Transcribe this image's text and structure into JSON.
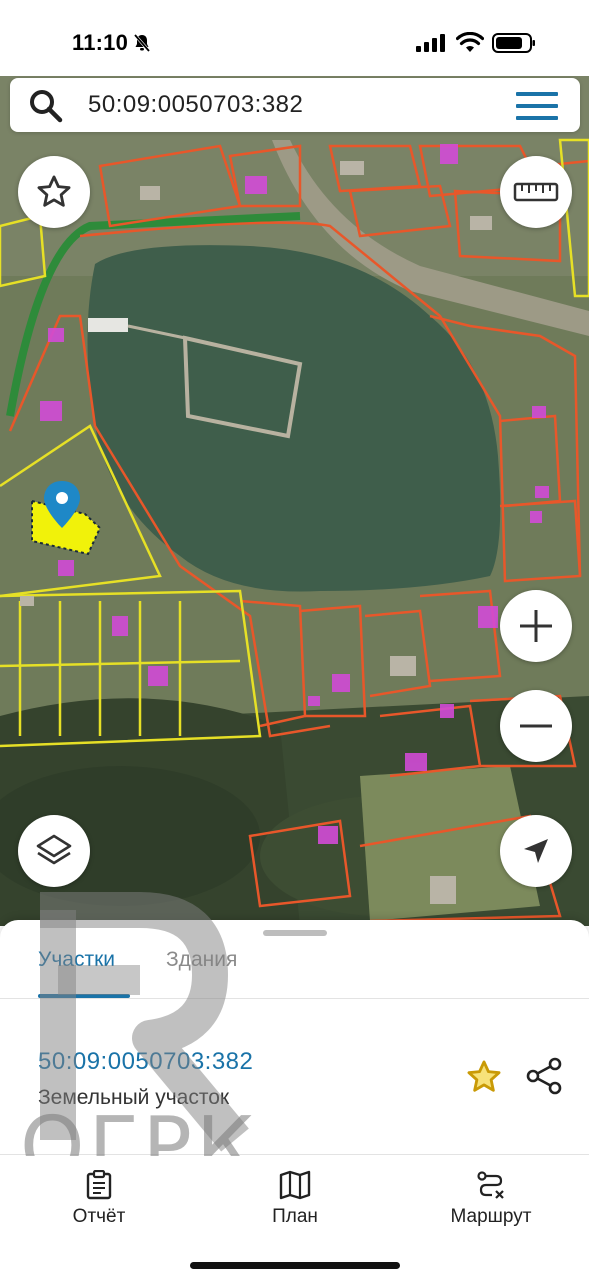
{
  "status_bar": {
    "time": "11:10",
    "icons": [
      "bell-slash-icon",
      "signal-icon",
      "wifi-icon",
      "battery-icon"
    ]
  },
  "search": {
    "value": "50:09:0050703:382",
    "icon": "search-icon",
    "menu_icon": "menu-icon"
  },
  "map": {
    "controls": [
      "star-icon",
      "ruler-icon",
      "zoom-in-icon",
      "zoom-out-icon",
      "layers-icon",
      "locate-icon"
    ],
    "colors": {
      "water": "#3f5e4b",
      "parcel_border": "#e8572a",
      "selected_parcel": "#f1f20a",
      "building": "#d14bd6",
      "pin": "#1e88c7"
    }
  },
  "sheet": {
    "tabs": [
      {
        "label": "Участки",
        "active": true
      },
      {
        "label": "Здания",
        "active": false
      }
    ],
    "result": {
      "cadastral_number": "50:09:0050703:382",
      "type": "Земельный участок"
    }
  },
  "watermark": {
    "text": "ОГРК"
  },
  "bottom_nav": {
    "items": [
      {
        "label": "Отчёт",
        "icon": "report-icon"
      },
      {
        "label": "План",
        "icon": "map-icon"
      },
      {
        "label": "Маршрут",
        "icon": "route-icon"
      }
    ]
  }
}
